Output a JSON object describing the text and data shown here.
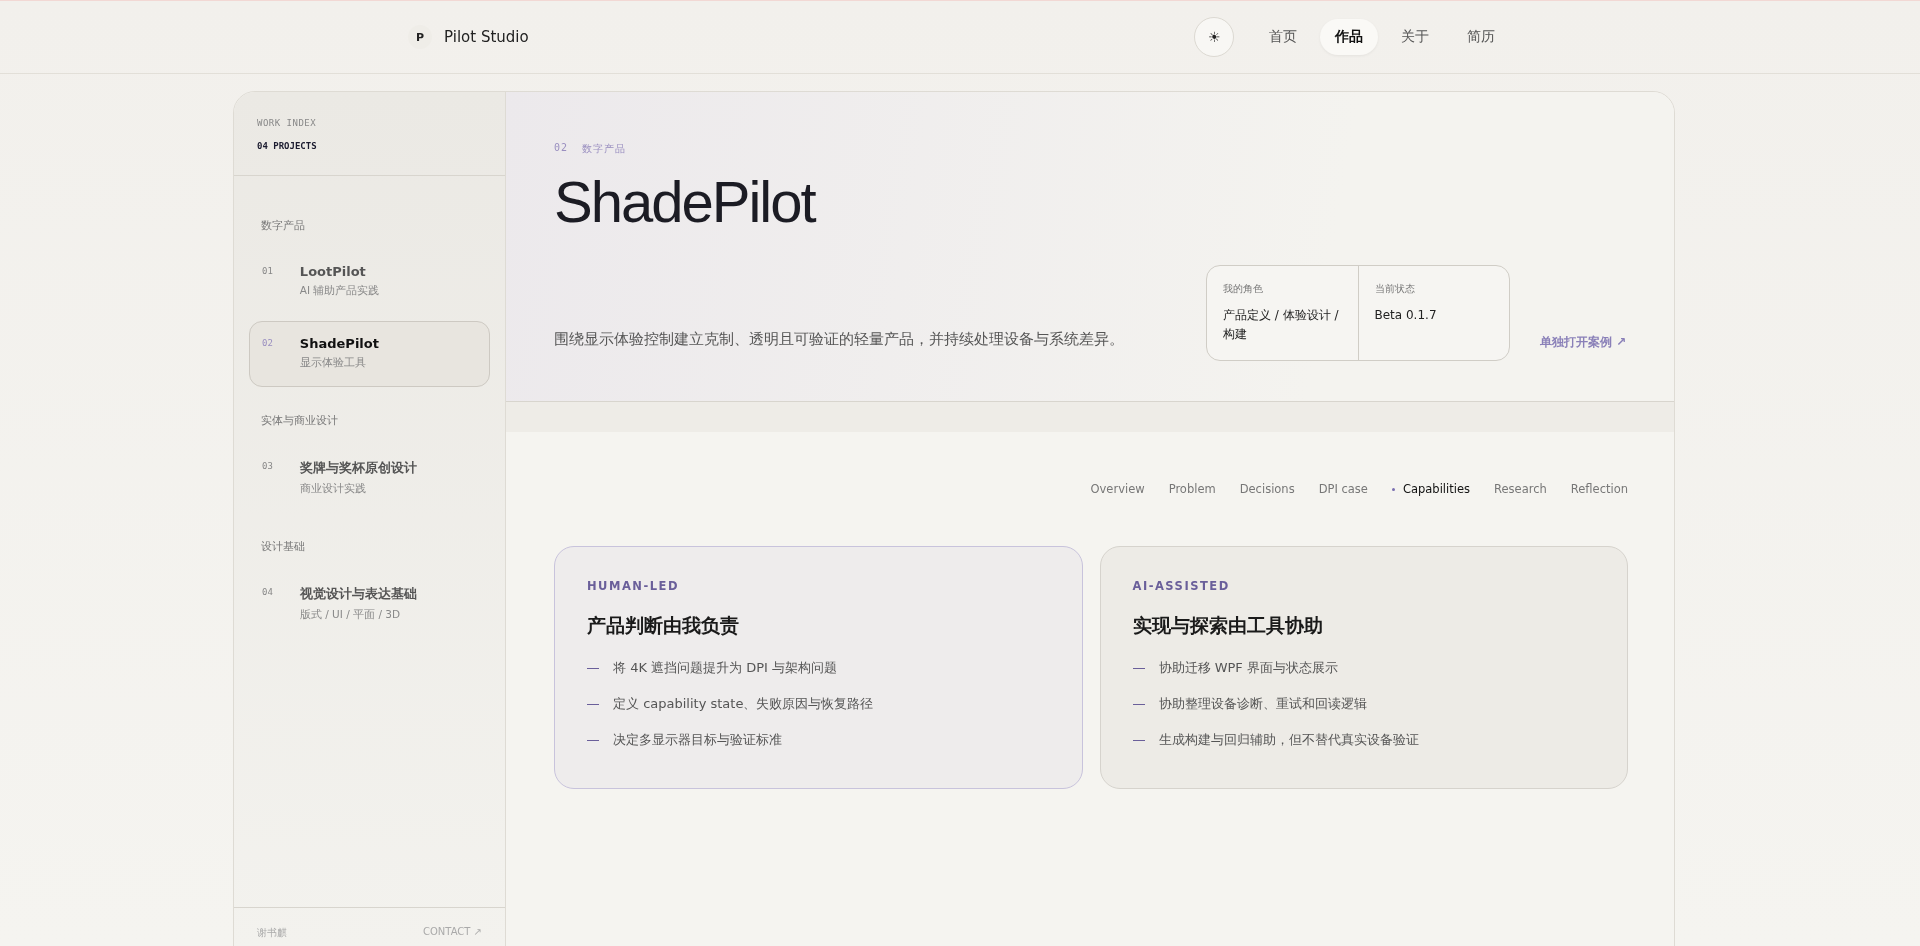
{
  "brand": {
    "logo": "P",
    "name": "Pilot Studio"
  },
  "theme_toggle": {
    "icon": "☀"
  },
  "nav": [
    {
      "label": "首页",
      "selected": false
    },
    {
      "label": "作品",
      "selected": true
    },
    {
      "label": "关于",
      "selected": false
    },
    {
      "label": "简历",
      "selected": false
    }
  ],
  "sidebar": {
    "eyebrow": "WORK INDEX",
    "count": "04 PROJECTS",
    "groups": [
      {
        "title": "数字产品",
        "items": [
          {
            "number": "01",
            "title": "LootPilot",
            "subtitle": "AI 辅助产品实践",
            "selected": false
          },
          {
            "number": "02",
            "title": "ShadePilot",
            "subtitle": "显示体验工具",
            "selected": true
          }
        ]
      },
      {
        "title": "实体与商业设计",
        "items": [
          {
            "number": "03",
            "title": "奖牌与奖杯原创设计",
            "subtitle": "商业设计实践",
            "selected": false
          }
        ]
      },
      {
        "title": "设计基础",
        "items": [
          {
            "number": "04",
            "title": "视觉设计与表达基础",
            "subtitle": "版式 / UI / 平面 / 3D",
            "selected": false
          }
        ]
      }
    ],
    "footer": {
      "name": "谢书麒",
      "contact": "CONTACT ↗"
    }
  },
  "header": {
    "number": "02",
    "category": "数字产品",
    "title": "ShadePilot",
    "summary": "围绕显示体验控制建立克制、透明且可验证的轻量产品，并持续处理设备与系统差异。",
    "facts": [
      {
        "label": "我的角色",
        "value": "产品定义 / 体验设计 / 构建"
      },
      {
        "label": "当前状态",
        "value": "Beta 0.1.7"
      }
    ],
    "open_link": "单独打开案例 ↗"
  },
  "section_nav": [
    {
      "label": "Overview",
      "selected": false
    },
    {
      "label": "Problem",
      "selected": false
    },
    {
      "label": "Decisions",
      "selected": false
    },
    {
      "label": "DPI case",
      "selected": false
    },
    {
      "label": "Capabilities",
      "selected": true
    },
    {
      "label": "Research",
      "selected": false
    },
    {
      "label": "Reflection",
      "selected": false
    }
  ],
  "cards": [
    {
      "kind": "human",
      "eyebrow": "HUMAN-LED",
      "title": "产品判断由我负责",
      "items": [
        "将 4K 遮挡问题提升为 DPI 与架构问题",
        "定义 capability state、失败原因与恢复路径",
        "决定多显示器目标与验证标准"
      ]
    },
    {
      "kind": "ai",
      "eyebrow": "AI-ASSISTED",
      "title": "实现与探索由工具协助",
      "items": [
        "协助迁移 WPF 界面与状态展示",
        "协助整理设备诊断、重试和回读逻辑",
        "生成构建与回归辅助，但不替代真实设备验证"
      ]
    }
  ]
}
